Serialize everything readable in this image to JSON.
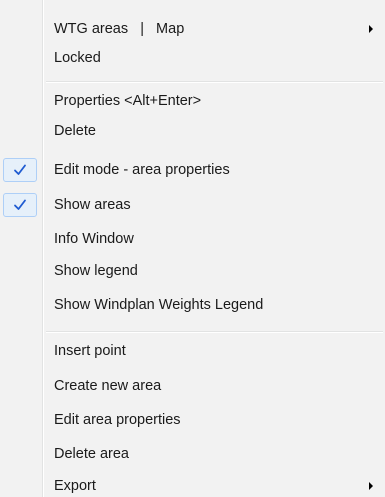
{
  "menu": {
    "group1": [
      {
        "label": "WTG areas   |   Map",
        "submenu": true
      },
      {
        "label": "Locked"
      }
    ],
    "group2": [
      {
        "label": "Properties <Alt+Enter>"
      },
      {
        "label": "Delete"
      },
      {
        "label": "Edit mode - area properties",
        "checked": true
      },
      {
        "label": "Show areas",
        "checked": true
      },
      {
        "label": "Info Window"
      },
      {
        "label": "Show legend"
      },
      {
        "label": "Show Windplan Weights Legend"
      }
    ],
    "group3": [
      {
        "label": "Insert point"
      },
      {
        "label": "Create new area"
      },
      {
        "label": "Edit area properties"
      },
      {
        "label": "Delete area"
      },
      {
        "label": "Export",
        "submenu": true
      }
    ]
  },
  "colors": {
    "check": "#1f5bd1",
    "check_bg": "#e6f0fa",
    "check_border": "#aecff7"
  },
  "icons": {
    "check": "checkmark-icon",
    "submenu": "submenu-arrow-icon"
  }
}
